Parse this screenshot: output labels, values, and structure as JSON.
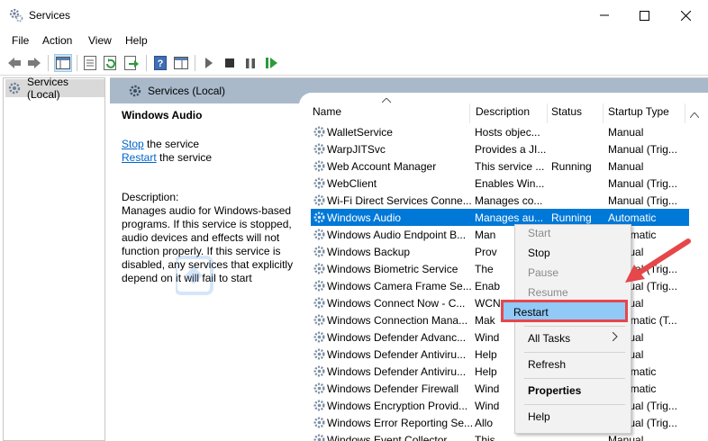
{
  "window": {
    "title": "Services"
  },
  "menu": [
    "File",
    "Action",
    "View",
    "Help"
  ],
  "tree": {
    "item": "Services (Local)"
  },
  "content": {
    "header": "Services (Local)"
  },
  "detail": {
    "service_name": "Windows Audio",
    "stop_link": "Stop",
    "stop_rest": " the service",
    "restart_link": "Restart",
    "restart_rest": " the service",
    "description_label": "Description:",
    "description": "Manages audio for Windows-based programs.  If this service is stopped, audio devices and effects will not function properly.  If this service is disabled, any services that explicitly depend on it will fail to start"
  },
  "columns": [
    "Name",
    "Description",
    "Status",
    "Startup Type"
  ],
  "services": [
    {
      "name": "WalletService",
      "description": "Hosts objec...",
      "status": "",
      "startup": "Manual"
    },
    {
      "name": "WarpJITSvc",
      "description": "Provides a JI...",
      "status": "",
      "startup": "Manual (Trig..."
    },
    {
      "name": "Web Account Manager",
      "description": "This service ...",
      "status": "Running",
      "startup": "Manual"
    },
    {
      "name": "WebClient",
      "description": "Enables Win...",
      "status": "",
      "startup": "Manual (Trig..."
    },
    {
      "name": "Wi-Fi Direct Services Conne...",
      "description": "Manages co...",
      "status": "",
      "startup": "Manual (Trig..."
    },
    {
      "name": "Windows Audio",
      "description": "Manages au...",
      "status": "Running",
      "startup": "Automatic"
    },
    {
      "name": "Windows Audio Endpoint B...",
      "description": "Man",
      "status": "",
      "startup": "Automatic"
    },
    {
      "name": "Windows Backup",
      "description": "Prov",
      "status": "",
      "startup": "Manual"
    },
    {
      "name": "Windows Biometric Service",
      "description": "The",
      "status": "",
      "startup": "Manual (Trig..."
    },
    {
      "name": "Windows Camera Frame Se...",
      "description": "Enab",
      "status": "",
      "startup": "Manual (Trig..."
    },
    {
      "name": "Windows Connect Now - C...",
      "description": "WCN",
      "status": "",
      "startup": "Manual"
    },
    {
      "name": "Windows Connection Mana...",
      "description": "Mak",
      "status": "",
      "startup": "Automatic (T..."
    },
    {
      "name": "Windows Defender Advanc...",
      "description": "Wind",
      "status": "",
      "startup": "Manual"
    },
    {
      "name": "Windows Defender Antiviru...",
      "description": "Help",
      "status": "",
      "startup": "Manual"
    },
    {
      "name": "Windows Defender Antiviru...",
      "description": "Help",
      "status": "",
      "startup": "Automatic"
    },
    {
      "name": "Windows Defender Firewall",
      "description": "Wind",
      "status": "",
      "startup": "Automatic"
    },
    {
      "name": "Windows Encryption Provid...",
      "description": "Wind",
      "status": "",
      "startup": "Manual (Trig..."
    },
    {
      "name": "Windows Error Reporting Se...",
      "description": "Allo",
      "status": "",
      "startup": "Manual (Trig..."
    },
    {
      "name": "Windows Event Collector",
      "description": "This",
      "status": "",
      "startup": "Manual"
    }
  ],
  "context_menu": {
    "start": "Start",
    "stop": "Stop",
    "pause": "Pause",
    "resume": "Resume",
    "restart": "Restart",
    "all_tasks": "All Tasks",
    "refresh": "Refresh",
    "properties": "Properties",
    "help": "Help"
  },
  "colors": {
    "selection": "#0078d7",
    "header_band": "#a9b9ca",
    "highlight_border": "#e5474b",
    "highlight_fill": "#91c9f7",
    "link": "#0066cc"
  },
  "icons": [
    "services-icon",
    "back-icon",
    "forward-icon",
    "console-tree-icon",
    "properties-icon",
    "refresh-icon",
    "export-icon",
    "help-icon",
    "view-icon",
    "play-icon",
    "stop-icon",
    "pause-icon",
    "restart-icon",
    "gear-icon",
    "red-arrow-icon"
  ]
}
